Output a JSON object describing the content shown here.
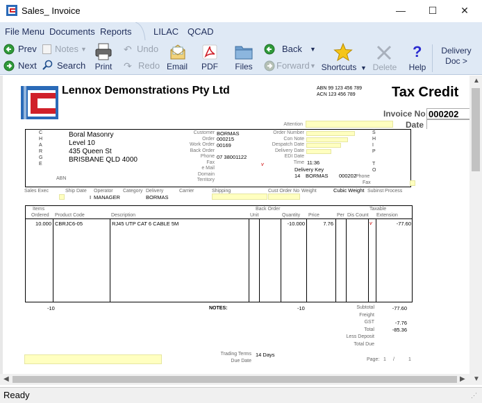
{
  "window": {
    "title": "Sales_ Invoice",
    "minimize": "—",
    "maximize": "☐",
    "close": "✕"
  },
  "menu": {
    "items": [
      "File Menu",
      "Documents",
      "Reports",
      "LILAC",
      "QCAD"
    ]
  },
  "toolbar": {
    "prev": "Prev",
    "next": "Next",
    "notes": "Notes",
    "search": "Search",
    "print": "Print",
    "undo": "Undo",
    "redo": "Redo",
    "email": "Email",
    "pdf": "PDF",
    "files": "Files",
    "back": "Back",
    "forward": "Forward",
    "shortcuts": "Shortcuts",
    "delete": "Delete",
    "help": "Help",
    "delivery_doc_1": "Delivery",
    "delivery_doc_2": "Doc >"
  },
  "invoice": {
    "company": "Lennox Demonstrations Pty Ltd",
    "abn": "ABN 99 123 456 789",
    "acn": "ACN 123 456 789",
    "doc_type": "Tax Credit",
    "invoice_no_label": "Invoice No",
    "invoice_no": "000202",
    "date_label": "Date",
    "attention_label": "Attention",
    "charge_letters": [
      "C",
      "H",
      "A",
      "R",
      "G",
      "E"
    ],
    "ship_letters": [
      "S",
      "H",
      "I",
      "P",
      "",
      "T",
      "O"
    ],
    "address": [
      "Boral Masonry",
      "Level 10",
      "435 Queen St",
      "BRISBANE QLD 4000"
    ],
    "abn_label": "ABN",
    "customer_fields": [
      {
        "label": "Customer",
        "value": "BORMAS"
      },
      {
        "label": "Order",
        "value": "000215"
      },
      {
        "label": "Work Order",
        "value": "00169"
      },
      {
        "label": "Back Order",
        "value": ""
      },
      {
        "label": "Phone",
        "value": "07 38001122"
      },
      {
        "label": "Fax",
        "value": ""
      },
      {
        "label": "e Mail",
        "value": ""
      },
      {
        "label": "Domain",
        "value": ""
      },
      {
        "label": "Territory",
        "value": ""
      }
    ],
    "order_fields": [
      {
        "label": "Order Number",
        "value": ""
      },
      {
        "label": "Con Note",
        "value": ""
      },
      {
        "label": "Despatch Date",
        "value": ""
      },
      {
        "label": "Delivery Date",
        "value": ""
      },
      {
        "label": "EDI Date",
        "value": ""
      },
      {
        "label": "Time",
        "value": "11:36"
      }
    ],
    "delivery_key_label": "Delivery Key",
    "delivery_key_num": "14",
    "delivery_key_code": "BORMAS",
    "delivery_key_inv": "000202",
    "phone_label": "Phone",
    "fax_label": "Fax",
    "row_labels": {
      "sales_exec": "Sales Exec",
      "ship_date": "Ship Date",
      "operator": "Operator",
      "category": "Category",
      "delivery": "Delivery",
      "carrier": "Carrier",
      "shipping": "Shipping",
      "cust_order_no": "Cust Order No",
      "weight": "Weight",
      "cubic_weight": "Cubic Weight",
      "subinst": "Subinst",
      "process": "Process"
    },
    "operator_value": "MANAGER",
    "operator_prefix": "I",
    "delivery_value": "BORMAS",
    "table_headers": {
      "items": "Items",
      "back_order": "Back Order",
      "taxable": "Taxable",
      "ordered": "Ordered",
      "product_code": "Product Code",
      "description": "Description",
      "unit": "Unit",
      "quantity": "Quantity",
      "price": "Price",
      "per": "Per",
      "dis_count": "Dis Count",
      "extension": "Extension"
    },
    "lines": [
      {
        "ordered": "10.000",
        "code": "CBRJC6-05",
        "description": "RJ45 UTP CAT 6 CABLE 5M",
        "quantity": "-10.000",
        "price": "7.76",
        "extension": "-77.60"
      }
    ],
    "total_ordered": "-10",
    "notes_label": "NOTES:",
    "total_qty": "-10",
    "totals": [
      {
        "label": "Subtotal",
        "value": "-77.60"
      },
      {
        "label": "Freight",
        "value": ""
      },
      {
        "label": "GST",
        "value": "-7.76"
      },
      {
        "label": "Total",
        "value": "-85.36"
      },
      {
        "label": "Less Deposit",
        "value": ""
      },
      {
        "label": "Total Due",
        "value": ""
      }
    ],
    "trading_terms_label": "Trading Terms",
    "trading_terms_value": "14 Days",
    "due_date_label": "Due Date",
    "page_label": "Page:",
    "page_num": "1",
    "page_sep": "/",
    "page_total": "1"
  },
  "status": {
    "text": "Ready"
  },
  "colors": {
    "chrome": "#dfe9f5",
    "field_yellow": "#ffffc0",
    "logo_blue": "#2a6ab8",
    "logo_red": "#d0202a"
  }
}
